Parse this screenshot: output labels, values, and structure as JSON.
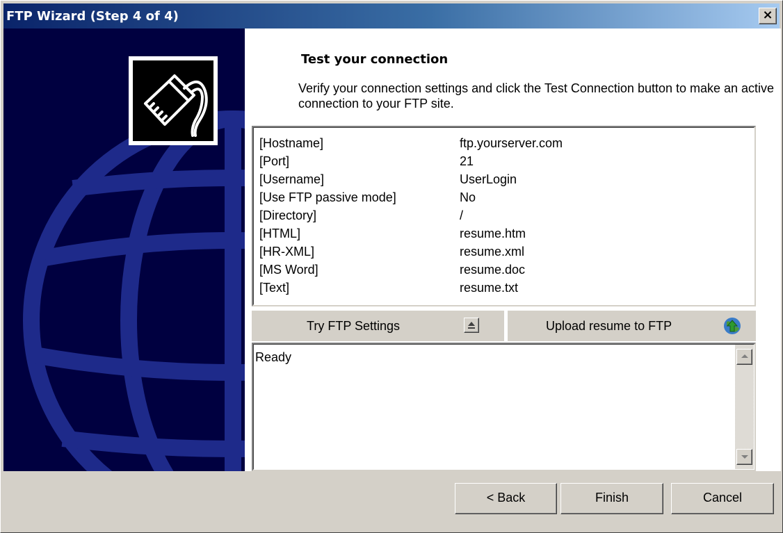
{
  "window": {
    "title": "FTP Wizard (Step 4  of 4)",
    "close_glyph": "×"
  },
  "side_panel": {
    "image": "globe-graphic",
    "icon": "network-connector-icon"
  },
  "page": {
    "heading": "Test your connection",
    "description": "Verify your connection settings and click the Test Connection button to make an active connection to your FTP site."
  },
  "settings": [
    {
      "key": "[Hostname]",
      "value": "ftp.yourserver.com"
    },
    {
      "key": "[Port]",
      "value": "21"
    },
    {
      "key": "[Username]",
      "value": "UserLogin"
    },
    {
      "key": "[Use FTP passive mode]",
      "value": "No"
    },
    {
      "key": "[Directory]",
      "value": "/"
    },
    {
      "key": "[HTML]",
      "value": "resume.htm"
    },
    {
      "key": "[HR-XML]",
      "value": "resume.xml"
    },
    {
      "key": "[MS Word]",
      "value": "resume.doc"
    },
    {
      "key": "[Text]",
      "value": "resume.txt"
    }
  ],
  "actions": {
    "try_ftp_label": "Try FTP Settings",
    "try_ftp_icon": "eject-icon",
    "upload_label": "Upload resume to FTP",
    "upload_icon": "globe-upload-icon"
  },
  "log": {
    "text": "Ready"
  },
  "footer": {
    "back_label": "< Back",
    "finish_label": "Finish",
    "cancel_label": "Cancel"
  },
  "colors": {
    "title_start": "#0a246a",
    "title_end": "#a6caf0",
    "side_panel_bg": "#000040",
    "globe_lines": "#1e2a8a",
    "dialog_face": "#d4d0c8"
  }
}
